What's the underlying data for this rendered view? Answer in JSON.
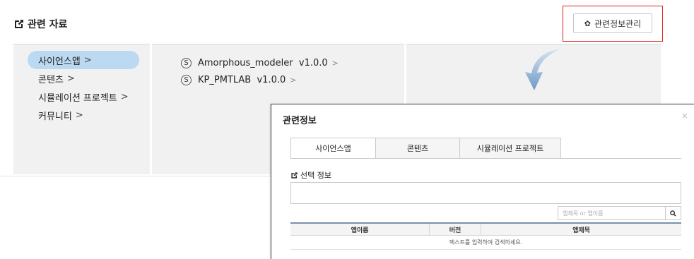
{
  "section": {
    "title": "관련 자료",
    "icon": "external-link-icon"
  },
  "manage_button": {
    "label": "관련정보관리",
    "icon": "gear-icon"
  },
  "categories": [
    {
      "label": "사이언스앱",
      "active": true
    },
    {
      "label": "콘텐츠",
      "active": false
    },
    {
      "label": "시뮬레이션 프로젝트",
      "active": false
    },
    {
      "label": "커뮤니티",
      "active": false
    }
  ],
  "chevron": ">",
  "apps": [
    {
      "badge": "S",
      "label": "Amorphous_modeler  v1.0.0"
    },
    {
      "badge": "S",
      "label": "KP_PMTLAB  v1.0.0"
    }
  ],
  "modal": {
    "title": "관련정보",
    "close": "×",
    "tabs": [
      {
        "label": "사이언스앱",
        "active": true
      },
      {
        "label": "콘텐츠",
        "active": false
      },
      {
        "label": "시뮬레이션 프로젝트",
        "active": false
      }
    ],
    "selected_label": "선택 정보",
    "search_placeholder": "앱제목 or 앱이름",
    "table": {
      "headers": [
        "앱이름",
        "버전",
        "앱제목"
      ],
      "empty_message": "텍스트를 입력하여 검색하세요."
    }
  },
  "colors": {
    "active_bg": "#bcd9f2",
    "highlight": "#e02020",
    "arrow": "#7fa6cf",
    "table_top": "#7a90b0"
  }
}
